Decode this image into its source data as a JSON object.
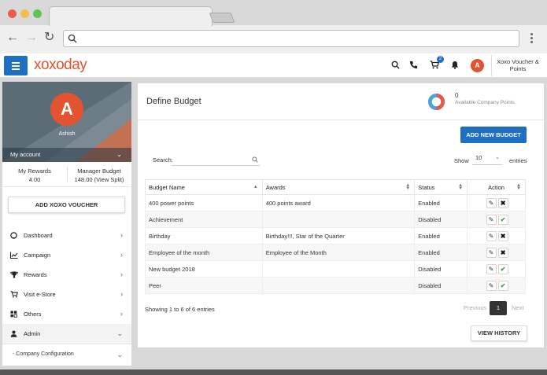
{
  "header": {
    "logo": "xoxoday",
    "cart_count": "2",
    "avatar_initial": "A",
    "user_label": "Xoxo Voucher & Points"
  },
  "profile": {
    "initial": "A",
    "name": "Ashish",
    "my_account": "My account",
    "my_rewards_label": "My Rewards",
    "my_rewards_value": "4.00",
    "manager_budget_label": "Manager Budget",
    "manager_budget_value": "148.00 (View Split)"
  },
  "sidebar": {
    "add_voucher": "ADD XOXO VOUCHER",
    "items": [
      {
        "label": "Dashboard",
        "icon": "dashboard-icon"
      },
      {
        "label": "Campaign",
        "icon": "chart-icon"
      },
      {
        "label": "Rewards",
        "icon": "trophy-icon"
      },
      {
        "label": "Visit e-Store",
        "icon": "cart-icon"
      },
      {
        "label": "Others",
        "icon": "others-icon"
      },
      {
        "label": "Admin",
        "icon": "admin-icon"
      }
    ],
    "sub_item": "- Company Configuration"
  },
  "main": {
    "title": "Define Budget",
    "points_value": "0",
    "points_label": "Available Company Points",
    "add_button": "ADD NEW BUDGET",
    "search_label": "Search:",
    "show_label": "Show",
    "show_value": "10",
    "entries_label": "entries",
    "columns": [
      "Budget Name",
      "Awards",
      "Status",
      "Action"
    ],
    "rows": [
      {
        "name": "400 power points",
        "awards": "400 points award",
        "status": "Enabled"
      },
      {
        "name": "Achievement",
        "awards": "",
        "status": "Disabled"
      },
      {
        "name": "Birthday",
        "awards": "Birthday!!!, Star of the Quarter",
        "status": "Enabled"
      },
      {
        "name": "Employee of the month",
        "awards": "Employee of the Month",
        "status": "Enabled"
      },
      {
        "name": "New budget 2018",
        "awards": "",
        "status": "Disabled"
      },
      {
        "name": "Peer",
        "awards": "",
        "status": "Disabled"
      }
    ],
    "showing": "Showing 1 to 6 of 6 entries",
    "previous": "Previous",
    "page": "1",
    "next": "Next",
    "history_button": "VIEW HISTORY"
  },
  "colors": {
    "brand": "#e3532f",
    "primary": "#1f6fc5",
    "donut_red": "#e05a4f",
    "donut_blue": "#4aa3df"
  }
}
